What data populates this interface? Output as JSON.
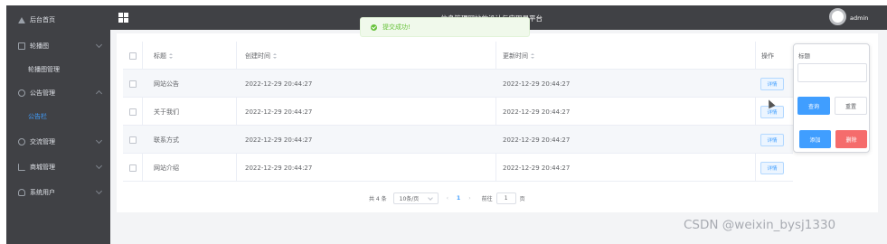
{
  "sidebar": {
    "items": [
      {
        "label": "后台首页",
        "icon": "home-icon"
      },
      {
        "label": "轮播图",
        "icon": "picture-icon"
      },
      {
        "label": "轮播图管理",
        "sub": true
      },
      {
        "label": "公告管理",
        "icon": "notice-icon"
      },
      {
        "label": "公告栏",
        "sub": true,
        "active": true
      },
      {
        "label": "交流管理",
        "icon": "chat-icon"
      },
      {
        "label": "商城管理",
        "icon": "cart-icon"
      },
      {
        "label": "系统用户",
        "icon": "user-icon"
      }
    ]
  },
  "header": {
    "title": "…信息管理网站的设计与实现易平台",
    "username": "admin"
  },
  "toast": {
    "message": "提交成功!",
    "color": "#67c23a"
  },
  "table": {
    "headers": {
      "title": "标题",
      "created": "创建时间",
      "updated": "更新时间",
      "ops": "操作"
    },
    "rows": [
      {
        "title": "网站公告",
        "created": "2022-12-29 20:44:27",
        "updated": "2022-12-29 20:44:27",
        "action": "详情"
      },
      {
        "title": "关于我们",
        "created": "2022-12-29 20:44:27",
        "updated": "2022-12-29 20:44:27",
        "action": "详情"
      },
      {
        "title": "联系方式",
        "created": "2022-12-29 20:44:27",
        "updated": "2022-12-29 20:44:27",
        "action": "详情"
      },
      {
        "title": "网站介绍",
        "created": "2022-12-29 20:44:27",
        "updated": "2022-12-29 20:44:27",
        "action": "详情"
      }
    ]
  },
  "search_panel": {
    "label": "标题",
    "input_value": "",
    "query": "查询",
    "reset": "重置",
    "add": "添加",
    "delete": "删除"
  },
  "pagination": {
    "total": "共 4 条",
    "page_size": "10条/页",
    "prev": "‹",
    "current": "1",
    "next": "›",
    "goto_prefix": "前往",
    "goto_value": "1",
    "goto_suffix": "页"
  },
  "watermark": "CSDN @weixin_bysj1330",
  "colors": {
    "primary": "#409eff",
    "danger": "#f56c6c",
    "success": "#67c23a",
    "sidebar": "#404145"
  }
}
